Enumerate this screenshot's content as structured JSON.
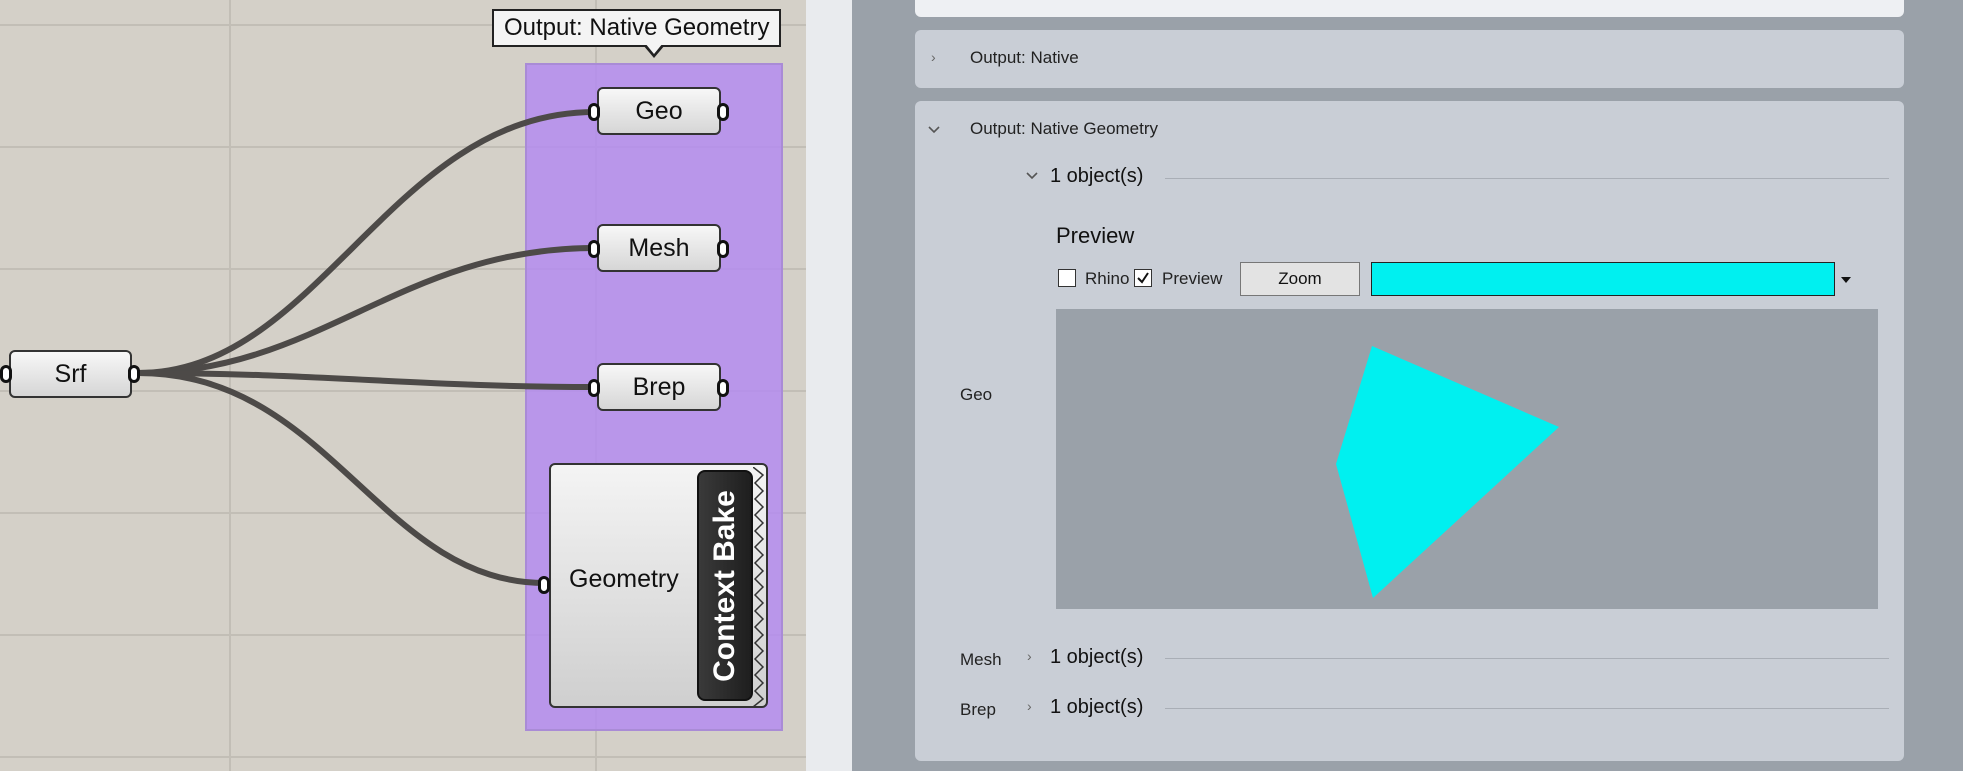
{
  "canvas": {
    "tooltip": "Output: Native Geometry",
    "source_node": {
      "label": "Srf"
    },
    "output_nodes": [
      {
        "label": "Geo"
      },
      {
        "label": "Mesh"
      },
      {
        "label": "Brep"
      }
    ],
    "bake_node": {
      "input_label": "Geometry",
      "title": "Context Bake"
    },
    "group_color": "#b48cf0",
    "canvas_color": "#d4d0c8"
  },
  "panel": {
    "sections": [
      {
        "title": "Output: Native",
        "expanded": false
      },
      {
        "title": "Output: Native Geometry",
        "expanded": true
      }
    ],
    "geo": {
      "side_label": "Geo",
      "objects_label": "1 object(s)",
      "preview_title": "Preview",
      "rhino_label": "Rhino",
      "rhino_checked": false,
      "preview_label": "Preview",
      "preview_checked": true,
      "zoom_label": "Zoom",
      "color": "#00f0f0"
    },
    "mesh": {
      "side_label": "Mesh",
      "objects_label": "1 object(s)"
    },
    "brep": {
      "side_label": "Brep",
      "objects_label": "1 object(s)"
    },
    "viewport_bg": "#9aa1a9",
    "geometry_color": "#00f0f0"
  }
}
